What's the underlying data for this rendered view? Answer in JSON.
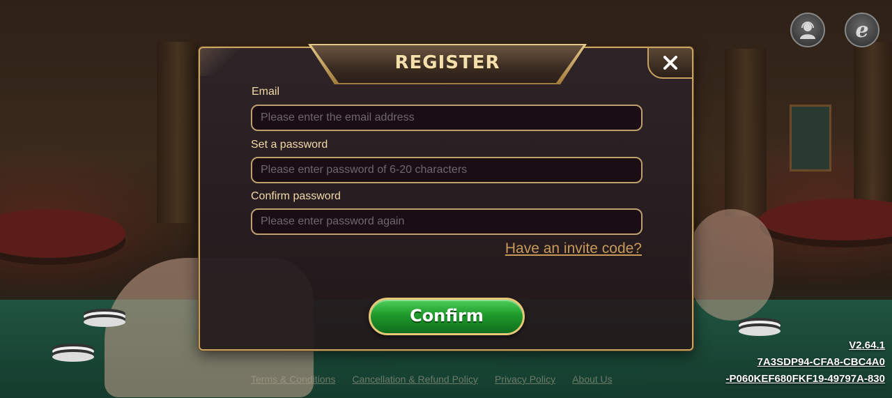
{
  "dialog": {
    "title": "REGISTER",
    "close_icon": "close-icon",
    "email": {
      "label": "Email",
      "placeholder": "Please enter the email address",
      "value": ""
    },
    "password": {
      "label": "Set a password",
      "placeholder": "Please enter password of 6-20 characters",
      "value": ""
    },
    "confirm_password": {
      "label": "Confirm password",
      "placeholder": "Please enter password again",
      "value": ""
    },
    "invite_link": "Have an invite code?",
    "confirm_button": "Confirm"
  },
  "top_icons": [
    "support-agent-icon",
    "browser-e-icon"
  ],
  "footer": {
    "links": [
      "Terms & Conditions",
      "Cancellation & Refund Policy",
      "Privacy Policy",
      "About Us"
    ]
  },
  "version": {
    "number": "V2.64.1",
    "id_line1": "7A3SDP94-CFA8-CBC4A0",
    "id_line2": "-P060KEF680FKF19-49797A-830"
  },
  "colors": {
    "accent_gold": "#c9a461",
    "label_gold": "#f1d9a8",
    "confirm_green": "#1f9a2c",
    "invite_link": "#c89a5a"
  }
}
